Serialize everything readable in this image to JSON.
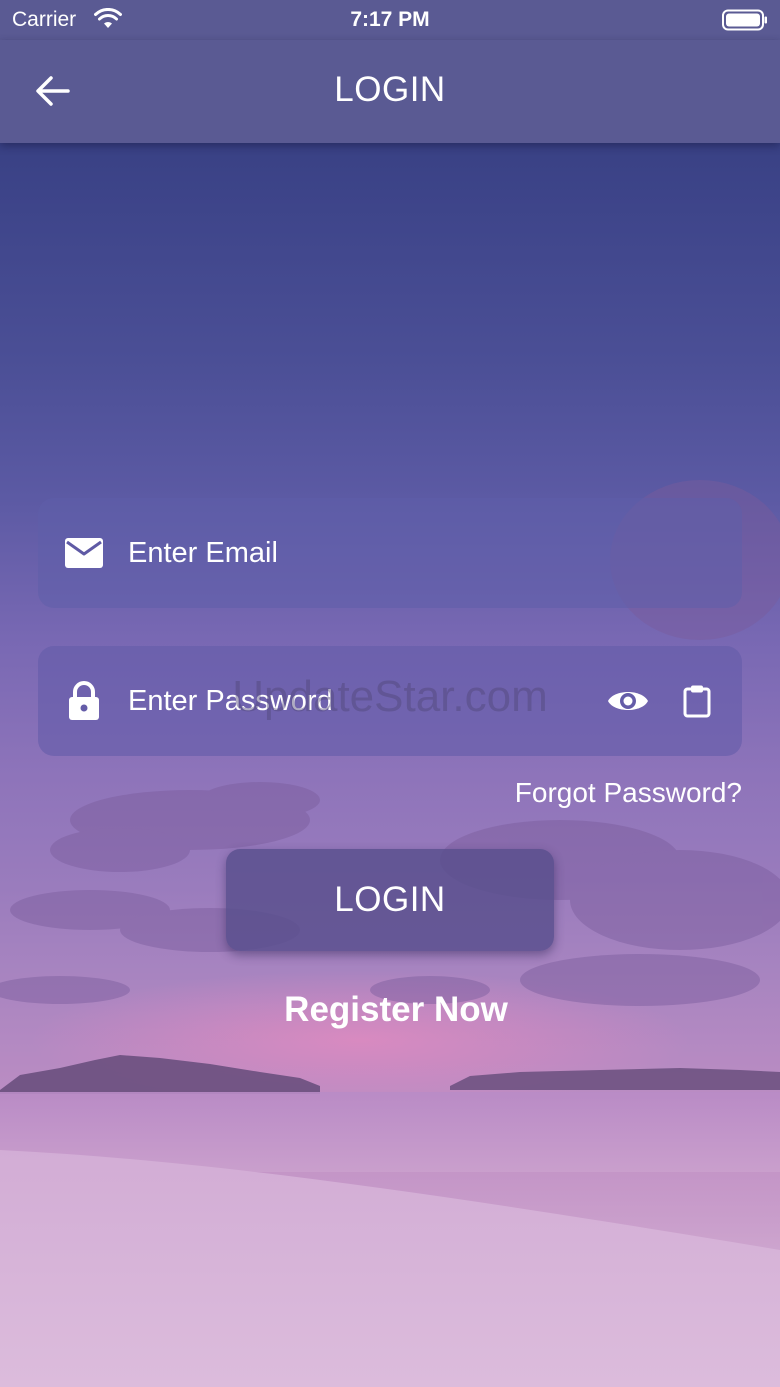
{
  "status_bar": {
    "carrier": "Carrier",
    "time": "7:17 PM"
  },
  "nav": {
    "title": "LOGIN"
  },
  "email": {
    "placeholder": "Enter Email"
  },
  "password": {
    "placeholder": "Enter Password"
  },
  "forgot_label": "Forgot Password?",
  "login_label": "LOGIN",
  "register_label": "Register Now",
  "watermark": "UpdateStar.com",
  "colors": {
    "nav_bar": "#5a5a93",
    "text": "#ffffff",
    "field_bg": "#5f5aa5",
    "button_bg": "#584e8c"
  },
  "icons": [
    "wifi-icon",
    "battery-icon",
    "back-arrow-icon",
    "mail-icon",
    "lock-icon",
    "eye-icon",
    "clipboard-icon"
  ]
}
